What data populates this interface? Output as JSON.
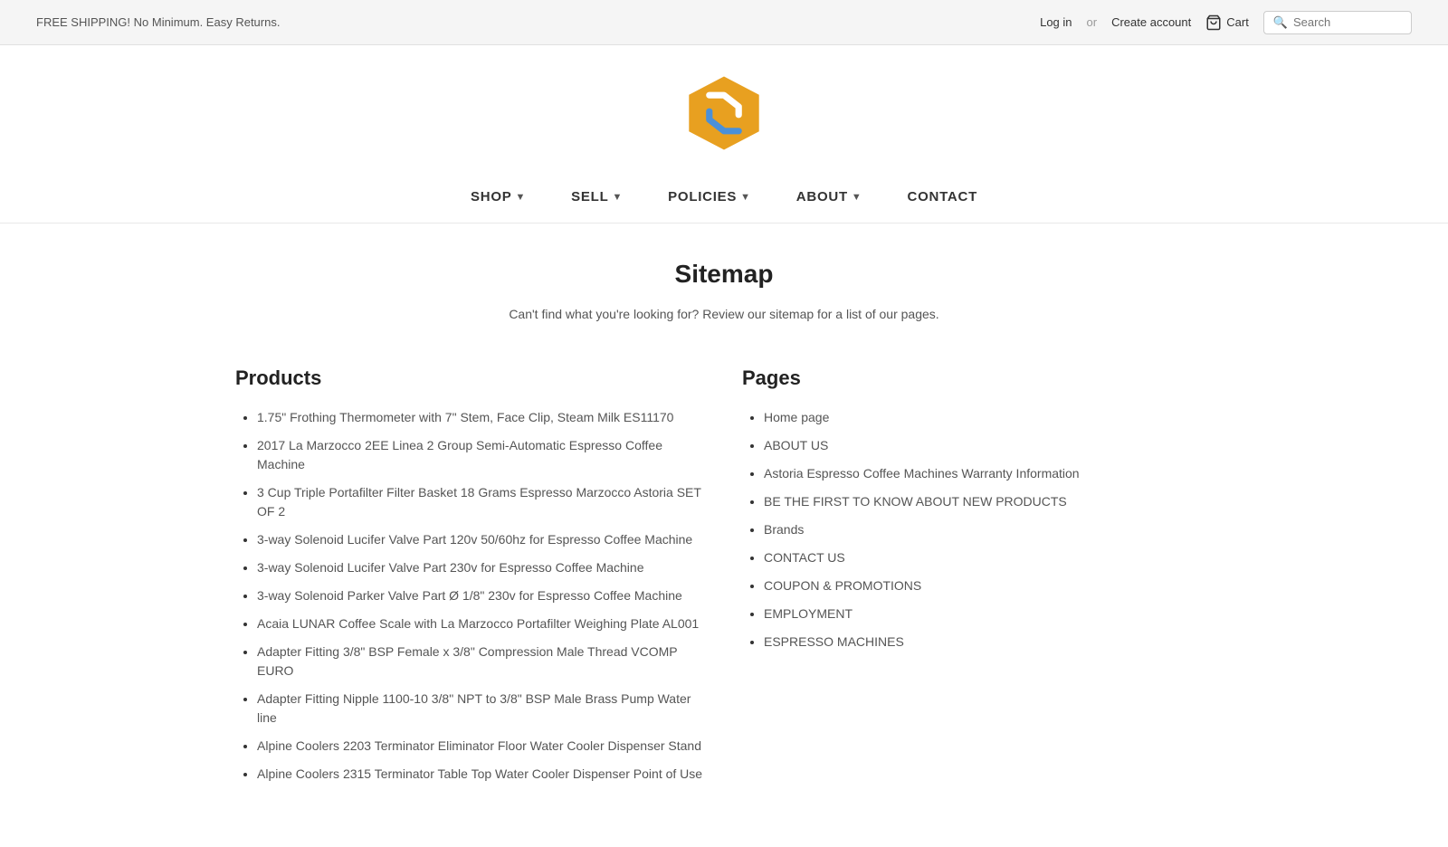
{
  "topbar": {
    "shipping_text": "FREE SHIPPING! No Minimum. Easy Returns.",
    "login_label": "Log in",
    "or_text": "or",
    "create_account_label": "Create account",
    "cart_label": "Cart",
    "search_placeholder": "Search"
  },
  "nav": {
    "items": [
      {
        "label": "SHOP",
        "has_chevron": true
      },
      {
        "label": "SELL",
        "has_chevron": true
      },
      {
        "label": "POLICIES",
        "has_chevron": true
      },
      {
        "label": "ABOUT",
        "has_chevron": true
      },
      {
        "label": "CONTACT",
        "has_chevron": false
      }
    ]
  },
  "page": {
    "title": "Sitemap",
    "subtitle": "Can't find what you're looking for? Review our sitemap for a list of our pages."
  },
  "products": {
    "section_title": "Products",
    "items": [
      "1.75\" Frothing Thermometer with 7\" Stem, Face Clip, Steam Milk ES11170",
      "2017 La Marzocco 2EE Linea 2 Group Semi-Automatic Espresso Coffee Machine",
      "3 Cup Triple Portafilter Filter Basket 18 Grams Espresso Marzocco Astoria SET OF 2",
      "3-way Solenoid Lucifer Valve Part 120v 50/60hz for Espresso Coffee Machine",
      "3-way Solenoid Lucifer Valve Part 230v for Espresso Coffee Machine",
      "3-way Solenoid Parker Valve Part Ø 1/8\" 230v for Espresso Coffee Machine",
      "Acaia LUNAR Coffee Scale with La Marzocco Portafilter Weighing Plate AL001",
      "Adapter Fitting 3/8\" BSP Female x 3/8\" Compression Male Thread VCOMP EURO",
      "Adapter Fitting Nipple 1100-10 3/8\" NPT to 3/8\" BSP Male Brass Pump Water line",
      "Alpine Coolers 2203 Terminator Eliminator Floor Water Cooler Dispenser Stand",
      "Alpine Coolers 2315 Terminator Table Top Water Cooler Dispenser Point of Use"
    ]
  },
  "pages": {
    "section_title": "Pages",
    "items": [
      "Home page",
      "ABOUT US",
      "Astoria Espresso Coffee Machines Warranty Information",
      "BE THE FIRST TO KNOW ABOUT NEW PRODUCTS",
      "Brands",
      "CONTACT US",
      "COUPON & PROMOTIONS",
      "EMPLOYMENT",
      "ESPRESSO MACHINES"
    ]
  }
}
